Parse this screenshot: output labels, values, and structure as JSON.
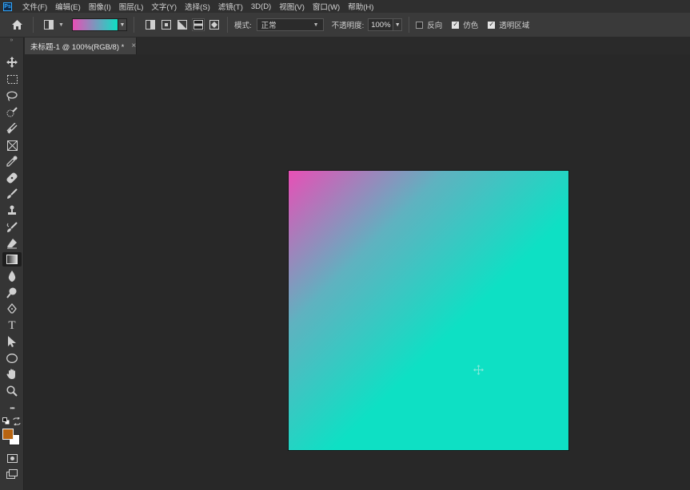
{
  "app": {
    "logo_text": "Ps",
    "menus": [
      "文件(F)",
      "编辑(E)",
      "图像(I)",
      "图层(L)",
      "文字(Y)",
      "选择(S)",
      "滤镜(T)",
      "3D(D)",
      "视图(V)",
      "窗口(W)",
      "帮助(H)"
    ]
  },
  "options": {
    "home_icon": "home-icon",
    "gradient": {
      "start_color": "#e84fb6",
      "end_color": "#0ee0c4"
    },
    "gradient_types": [
      "linear-gradient-icon",
      "radial-gradient-icon",
      "angle-gradient-icon",
      "reflected-gradient-icon",
      "diamond-gradient-icon"
    ],
    "active_gradient_type_index": 3,
    "mode_label": "模式:",
    "mode_value": "正常",
    "opacity_label": "不透明度:",
    "opacity_value": "100%",
    "reverse_label": "反向",
    "reverse_checked": false,
    "dither_label": "仿色",
    "dither_checked": true,
    "transparency_label": "透明区域",
    "transparency_checked": true
  },
  "document": {
    "tab_title": "未标题-1 @ 100%(RGB/8) *",
    "close_glyph": "×",
    "canvas": {
      "gradient_from": "#e84fb6",
      "gradient_mid": "#5fb2c0",
      "gradient_to": "#0ee0c4",
      "gradient_direction": "top-left to center"
    }
  },
  "toolbar": {
    "tools": [
      "move-tool-icon",
      "marquee-tool-icon",
      "lasso-tool-icon",
      "quick-select-tool-icon",
      "crop-tool-icon",
      "frame-tool-icon",
      "eyedropper-tool-icon",
      "healing-brush-tool-icon",
      "brush-tool-icon",
      "clone-stamp-tool-icon",
      "history-brush-tool-icon",
      "eraser-tool-icon",
      "gradient-tool-icon",
      "blur-tool-icon",
      "dodge-tool-icon",
      "pen-tool-icon",
      "type-tool-icon",
      "path-select-tool-icon",
      "ellipse-tool-icon",
      "hand-tool-icon",
      "zoom-tool-icon",
      "more-tools-icon"
    ],
    "active_tool": "gradient-tool-icon",
    "type_tool_glyph": "T",
    "more_glyph": "•••",
    "foreground_color": "#b86410",
    "background_color": "#ffffff"
  }
}
